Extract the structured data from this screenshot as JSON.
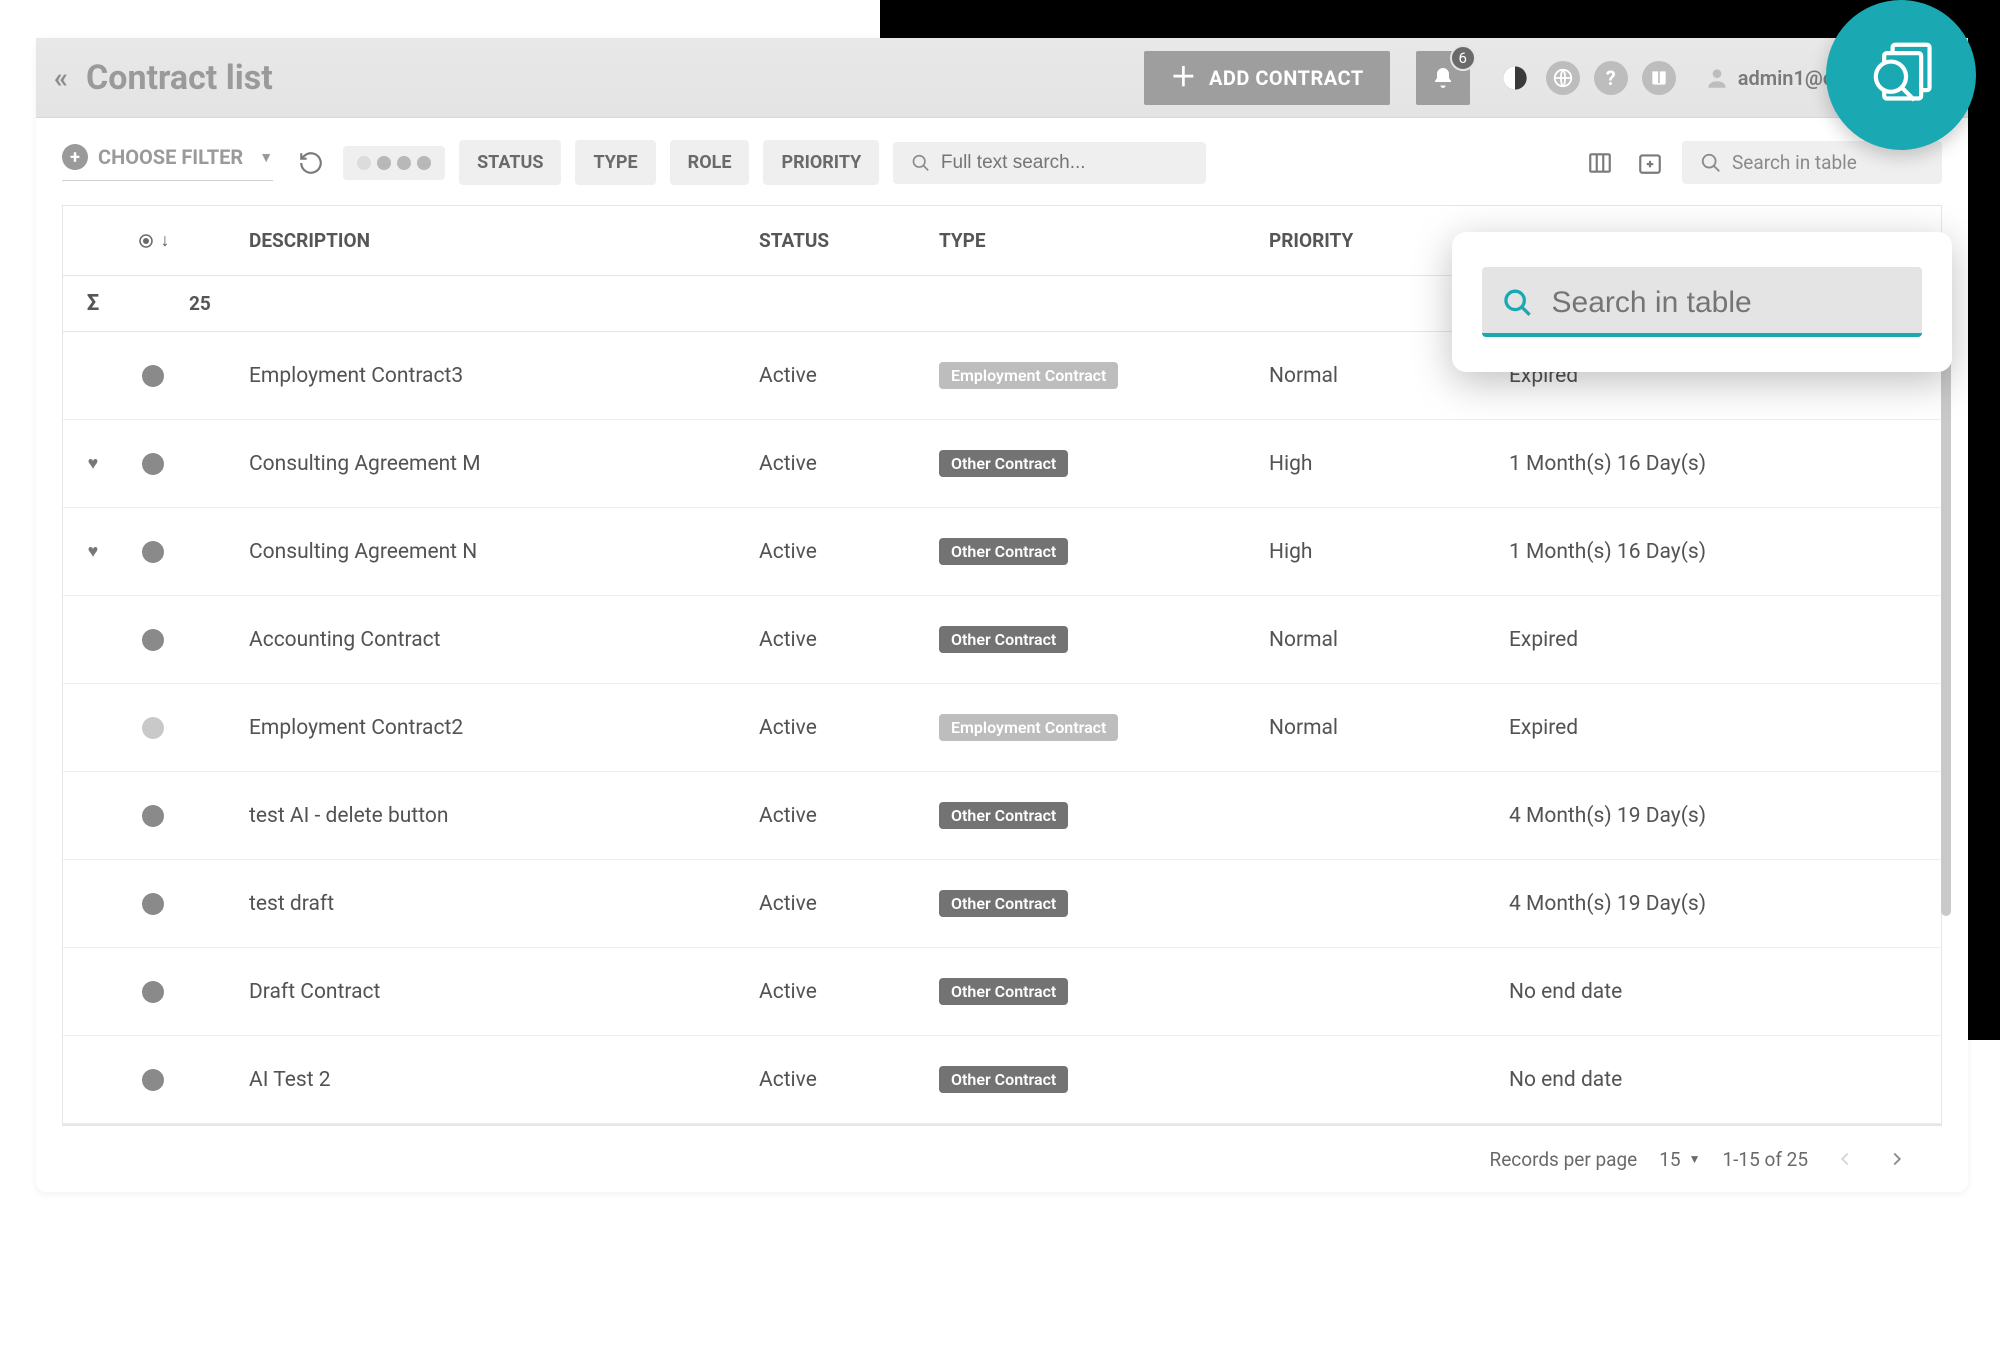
{
  "header": {
    "title": "Contract list",
    "add_button": "ADD CONTRACT",
    "notif_count": "6",
    "user_email": "admin1@contractsavep"
  },
  "filterbar": {
    "choose_filter": "CHOOSE FILTER",
    "chips": {
      "status": "STATUS",
      "type": "TYPE",
      "role": "ROLE",
      "priority": "PRIORITY"
    },
    "fulltext_placeholder": "Full text search...",
    "search_in_table_placeholder": "Search in table"
  },
  "callout": {
    "placeholder": "Search in table"
  },
  "columns": {
    "description": "DESCRIPTION",
    "status": "STATUS",
    "type": "TYPE",
    "priority": "PRIORITY"
  },
  "summary": {
    "sigma": "Σ",
    "count": "25"
  },
  "type_labels": {
    "employment": "Employment Contract",
    "other": "Other Contract"
  },
  "rows": [
    {
      "fav": false,
      "dot": "dark",
      "description": "Employment Contract3",
      "status": "Active",
      "type": "employment",
      "priority": "Normal",
      "end": "Expired"
    },
    {
      "fav": true,
      "dot": "dark",
      "description": "Consulting Agreement M",
      "status": "Active",
      "type": "other",
      "priority": "High",
      "end": "1 Month(s) 16 Day(s)"
    },
    {
      "fav": true,
      "dot": "dark",
      "description": "Consulting Agreement N",
      "status": "Active",
      "type": "other",
      "priority": "High",
      "end": "1 Month(s) 16 Day(s)"
    },
    {
      "fav": false,
      "dot": "dark",
      "description": "Accounting Contract",
      "status": "Active",
      "type": "other",
      "priority": "Normal",
      "end": "Expired"
    },
    {
      "fav": false,
      "dot": "light",
      "description": "Employment Contract2",
      "status": "Active",
      "type": "employment",
      "priority": "Normal",
      "end": "Expired"
    },
    {
      "fav": false,
      "dot": "dark",
      "description": "test AI - delete button",
      "status": "Active",
      "type": "other",
      "priority": "",
      "end": "4 Month(s) 19 Day(s)"
    },
    {
      "fav": false,
      "dot": "dark",
      "description": "test draft",
      "status": "Active",
      "type": "other",
      "priority": "",
      "end": "4 Month(s) 19 Day(s)"
    },
    {
      "fav": false,
      "dot": "dark",
      "description": "Draft Contract",
      "status": "Active",
      "type": "other",
      "priority": "",
      "end": "No end date"
    },
    {
      "fav": false,
      "dot": "dark",
      "description": "AI Test 2",
      "status": "Active",
      "type": "other",
      "priority": "",
      "end": "No end date"
    }
  ],
  "pager": {
    "records_per_page_label": "Records per page",
    "page_size": "15",
    "range": "1-15 of 25"
  }
}
